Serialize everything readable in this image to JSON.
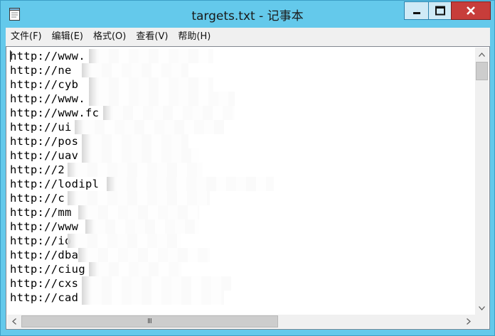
{
  "window": {
    "title": "targets.txt - 记事本",
    "icon": "notepad-icon"
  },
  "menu": [
    {
      "label": "文件(F)"
    },
    {
      "label": "编辑(E)"
    },
    {
      "label": "格式(O)"
    },
    {
      "label": "查看(V)"
    },
    {
      "label": "帮助(H)"
    }
  ],
  "editor": {
    "lines": [
      "http://www.",
      "http://ne",
      "http://cyb",
      "http://www.",
      "http://www.fc",
      "http://ui",
      "http://pos",
      "http://uav",
      "http://2",
      "http://lodipl",
      "http://c",
      "http://mm",
      "http://www",
      "http://io",
      "http://dba",
      "http://ciug",
      "http://cxs",
      "http://cad"
    ]
  },
  "scrollbars": {
    "horizontal_thumb_grip": "Ⅲ"
  },
  "colors": {
    "titlebar": "#64c9eb",
    "close_button": "#c73d3a",
    "menubar": "#f0f0f0",
    "editor_bg": "#ffffff"
  }
}
